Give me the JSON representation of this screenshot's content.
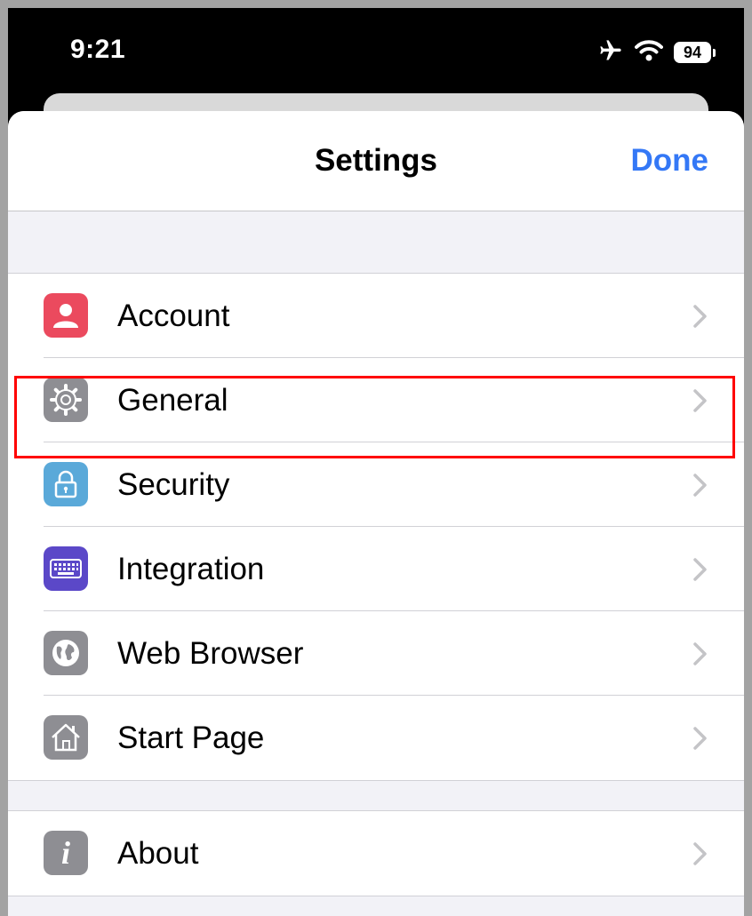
{
  "status_bar": {
    "time": "9:21",
    "battery": "94",
    "icons": [
      "airplane-icon",
      "wifi-icon",
      "battery-icon"
    ]
  },
  "nav": {
    "title": "Settings",
    "done_label": "Done"
  },
  "colors": {
    "accent": "#3478f6",
    "account_icon": "#eb4a5e",
    "general_icon": "#8e8e93",
    "security_icon": "#5aa9d9",
    "integration_icon": "#5b48c8",
    "web_browser_icon": "#8e8e93",
    "start_page_icon": "#8e8e93",
    "about_icon": "#8e8e93",
    "highlight": "#ff0000"
  },
  "groups": [
    {
      "items": [
        {
          "label": "Account",
          "icon": "person-icon"
        },
        {
          "label": "General",
          "icon": "gear-icon"
        },
        {
          "label": "Security",
          "icon": "lock-icon"
        },
        {
          "label": "Integration",
          "icon": "keyboard-icon"
        },
        {
          "label": "Web Browser",
          "icon": "globe-icon"
        },
        {
          "label": "Start Page",
          "icon": "house-icon"
        }
      ]
    },
    {
      "items": [
        {
          "label": "About",
          "icon": "info-icon"
        }
      ]
    }
  ]
}
